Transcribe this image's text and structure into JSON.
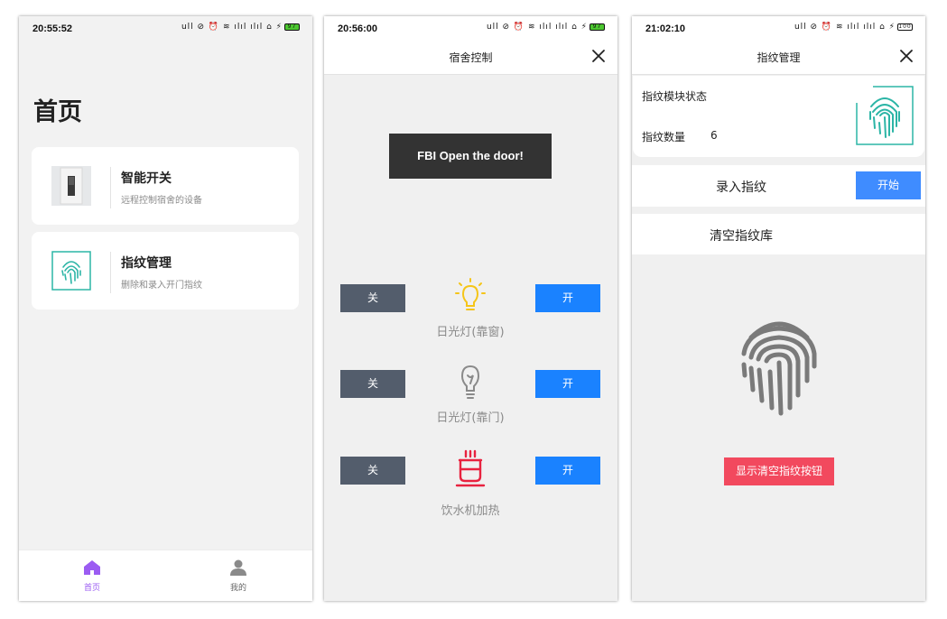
{
  "colors": {
    "accent": "#1a82ff",
    "tab_active": "#9b5cf2",
    "danger": "#f2495e",
    "off_button": "#535d6c"
  },
  "screen1": {
    "status_time": "20:55:52",
    "status_icons": "ull ⊘ ⏰ ≋ ılıl ılıl ⌂ ⚡",
    "battery": "97",
    "title": "首页",
    "cards": [
      {
        "title": "智能开关",
        "subtitle": "远程控制宿舍的设备",
        "icon": "light-switch-icon"
      },
      {
        "title": "指纹管理",
        "subtitle": "删除和录入开门指纹",
        "icon": "fingerprint-icon"
      }
    ],
    "tabs": [
      {
        "label": "首页",
        "icon": "home-icon",
        "active": true
      },
      {
        "label": "我的",
        "icon": "user-icon",
        "active": false
      }
    ]
  },
  "screen2": {
    "status_time": "20:56:00",
    "status_icons": "ull ⊘ ⏰ ≋ ılıl ılıl ⌂ ⚡",
    "battery": "97",
    "nav_title": "宿舍控制",
    "toast": "FBI Open the door!",
    "devices": [
      {
        "label": "日光灯(靠窗)",
        "off_label": "关",
        "on_label": "开",
        "icon": "lightbulb-on-icon"
      },
      {
        "label": "日光灯(靠门)",
        "off_label": "关",
        "on_label": "开",
        "icon": "lightbulb-off-icon"
      },
      {
        "label": "饮水机加热",
        "off_label": "关",
        "on_label": "开",
        "icon": "kettle-icon"
      }
    ]
  },
  "screen3": {
    "status_time": "21:02:10",
    "status_icons": "ull ⊘ ⏰ ≋ ılıl ılıl ⌂ ⚡",
    "battery": "100",
    "nav_title": "指纹管理",
    "module_status_label": "指纹模块状态",
    "count_label": "指纹数量",
    "count_value": "6",
    "enroll_label": "录入指纹",
    "start_button": "开始",
    "clear_label": "清空指纹库",
    "show_clear_button": "显示清空指纹按钮"
  }
}
